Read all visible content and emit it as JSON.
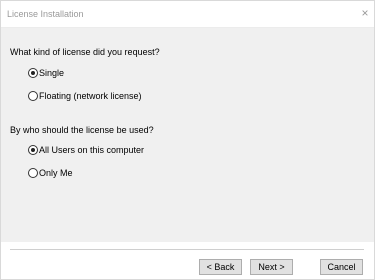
{
  "window": {
    "title": "License Installation",
    "close_glyph": "×"
  },
  "questions": {
    "license_kind": {
      "label": "What kind of license did you request?",
      "options": [
        {
          "label": "Single",
          "selected": true
        },
        {
          "label": "Floating (network license)",
          "selected": false
        }
      ]
    },
    "license_users": {
      "label": "By who should the license be used?",
      "options": [
        {
          "label": "All Users on this computer",
          "selected": true
        },
        {
          "label": "Only Me",
          "selected": false
        }
      ]
    }
  },
  "buttons": {
    "back": "< Back",
    "next": "Next >",
    "cancel": "Cancel"
  }
}
